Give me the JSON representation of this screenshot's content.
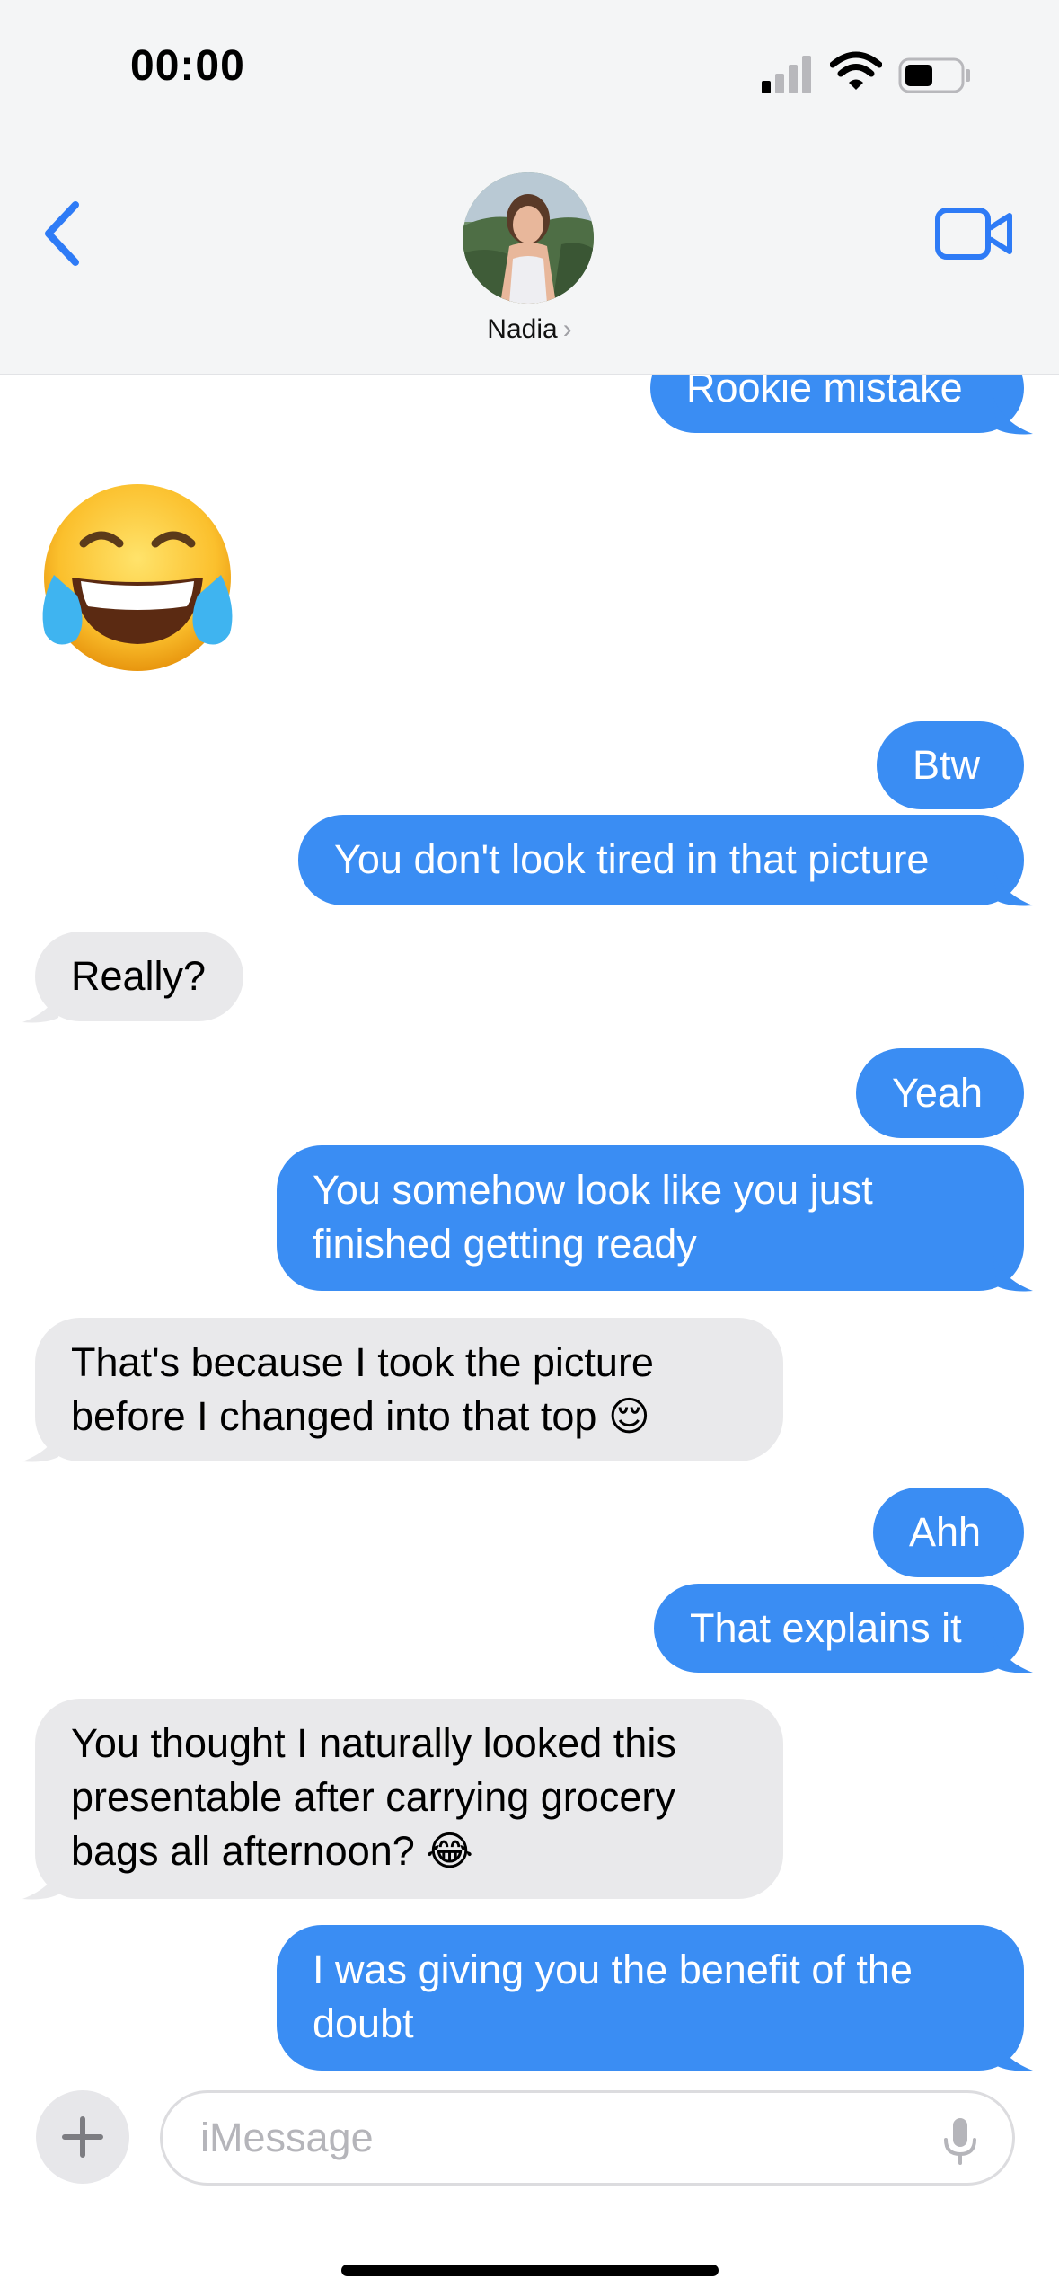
{
  "status_bar": {
    "time": "00:00"
  },
  "header": {
    "contact_name": "Nadia",
    "chevron": "›"
  },
  "messages": [
    {
      "from": "me",
      "text": "Rookie mistake"
    },
    {
      "from": "them",
      "emoji": "laughing-tears"
    },
    {
      "from": "me",
      "text": "Btw"
    },
    {
      "from": "me",
      "text": "You don't look tired in that picture"
    },
    {
      "from": "them",
      "text": "Really?"
    },
    {
      "from": "me",
      "text": "Yeah"
    },
    {
      "from": "me",
      "lines": [
        "You somehow look like you just",
        "finished getting ready"
      ]
    },
    {
      "from": "them",
      "lines": [
        "That's because I took the picture",
        "before I changed into that top 😌"
      ]
    },
    {
      "from": "me",
      "text": "Ahh"
    },
    {
      "from": "me",
      "text": "That explains it"
    },
    {
      "from": "them",
      "lines": [
        "You thought I naturally looked this",
        "presentable after carrying grocery",
        "bags all afternoon? 😂"
      ]
    },
    {
      "from": "me",
      "lines": [
        "I was giving you the benefit of the",
        "doubt"
      ]
    }
  ],
  "input": {
    "placeholder": "iMessage"
  },
  "colors": {
    "sent": "#3a8df3",
    "received": "#e9e9eb",
    "accent": "#2e7bf6"
  }
}
